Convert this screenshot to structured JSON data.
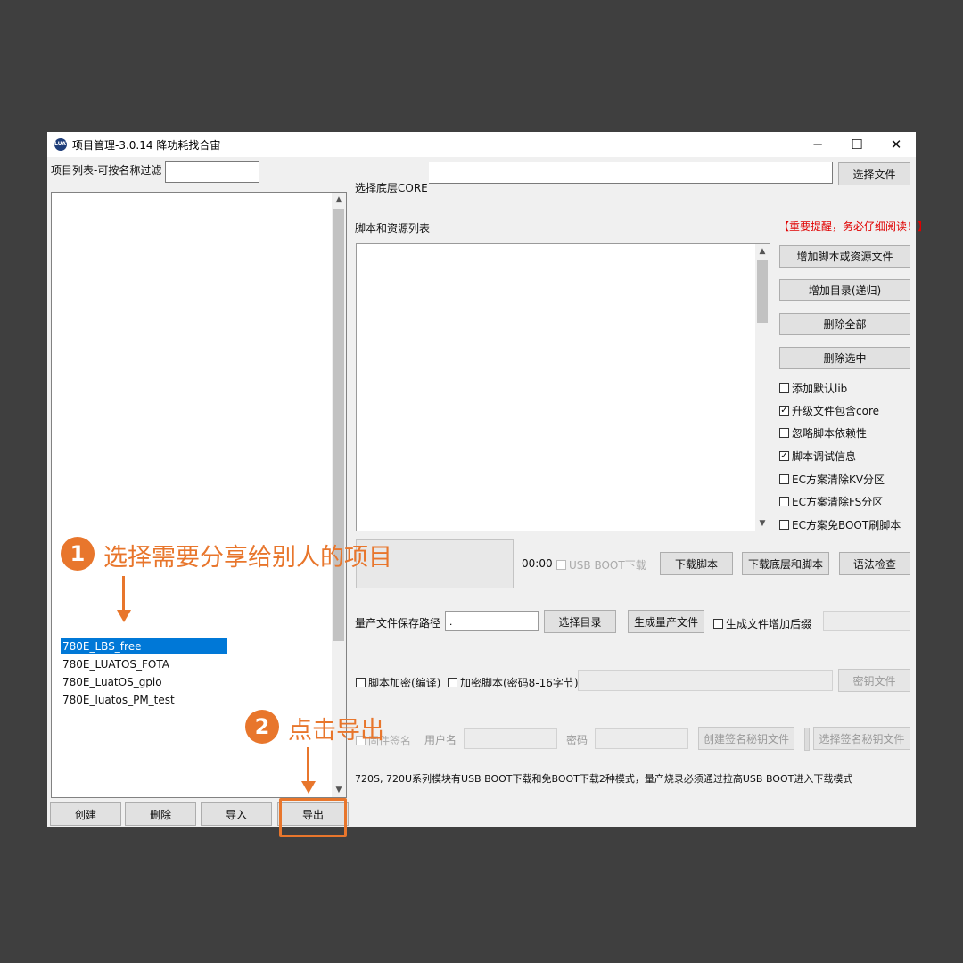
{
  "window": {
    "title": "项目管理-3.0.14 降功耗找合宙",
    "icon": "luat-logo-icon",
    "minimize": "─",
    "maximize": "☐",
    "close": "✕"
  },
  "left": {
    "filter_label": "项目列表-可按名称过滤",
    "filter_value": "",
    "projects": [
      "780E_LBS_free",
      "780E_LUATOS_FOTA",
      "780E_LuatOS_gpio",
      "780E_luatos_PM_test"
    ],
    "selected_index": 0,
    "buttons": {
      "create": "创建",
      "delete": "删除",
      "import": "导入",
      "export": "导出"
    }
  },
  "right": {
    "core_label": "选择底层CORE",
    "core_value": "",
    "choose_file": "选择文件",
    "script_list_label": "脚本和资源列表",
    "warning": "【重要提醒，务必仔细阅读！】",
    "side_buttons": [
      "增加脚本或资源文件",
      "增加目录(递归)",
      "删除全部",
      "删除选中"
    ],
    "options": [
      {
        "label": "添加默认lib",
        "checked": false
      },
      {
        "label": "升级文件包含core",
        "checked": true
      },
      {
        "label": "忽略脚本依赖性",
        "checked": false
      },
      {
        "label": "脚本调试信息",
        "checked": true
      },
      {
        "label": "EC方案清除KV分区",
        "checked": false
      },
      {
        "label": "EC方案清除FS分区",
        "checked": false
      },
      {
        "label": "EC方案免BOOT刷脚本",
        "checked": false
      }
    ],
    "timer": "00:00",
    "usb_boot_download": "USB BOOT下载",
    "download_script": "下载脚本",
    "download_core_script": "下载底层和脚本",
    "syntax_check": "语法检查",
    "mass_path_label": "量产文件保存路径",
    "mass_path_value": ".",
    "choose_dir": "选择目录",
    "gen_mass_file": "生成量产文件",
    "gen_suffix": "生成文件增加后缀",
    "script_encrypt": "脚本加密(编译)",
    "encrypt_script": "加密脚本(密码8-16字节)",
    "key_file": "密钥文件",
    "firmware_sign": "固件签名",
    "username": "用户名",
    "password": "密码",
    "create_sign_key": "创建签名秘钥文件",
    "select_sign_key": "选择签名秘钥文件",
    "footer_note": "720S, 720U系列模块有USB BOOT下载和免BOOT下载2种模式，量产烧录必须通过拉高USB BOOT进入下载模式"
  },
  "annotations": {
    "step1_num": "1",
    "step1_text": "选择需要分享给别人的项目",
    "step2_num": "2",
    "step2_text": "点击导出",
    "color": "#e8762c"
  }
}
